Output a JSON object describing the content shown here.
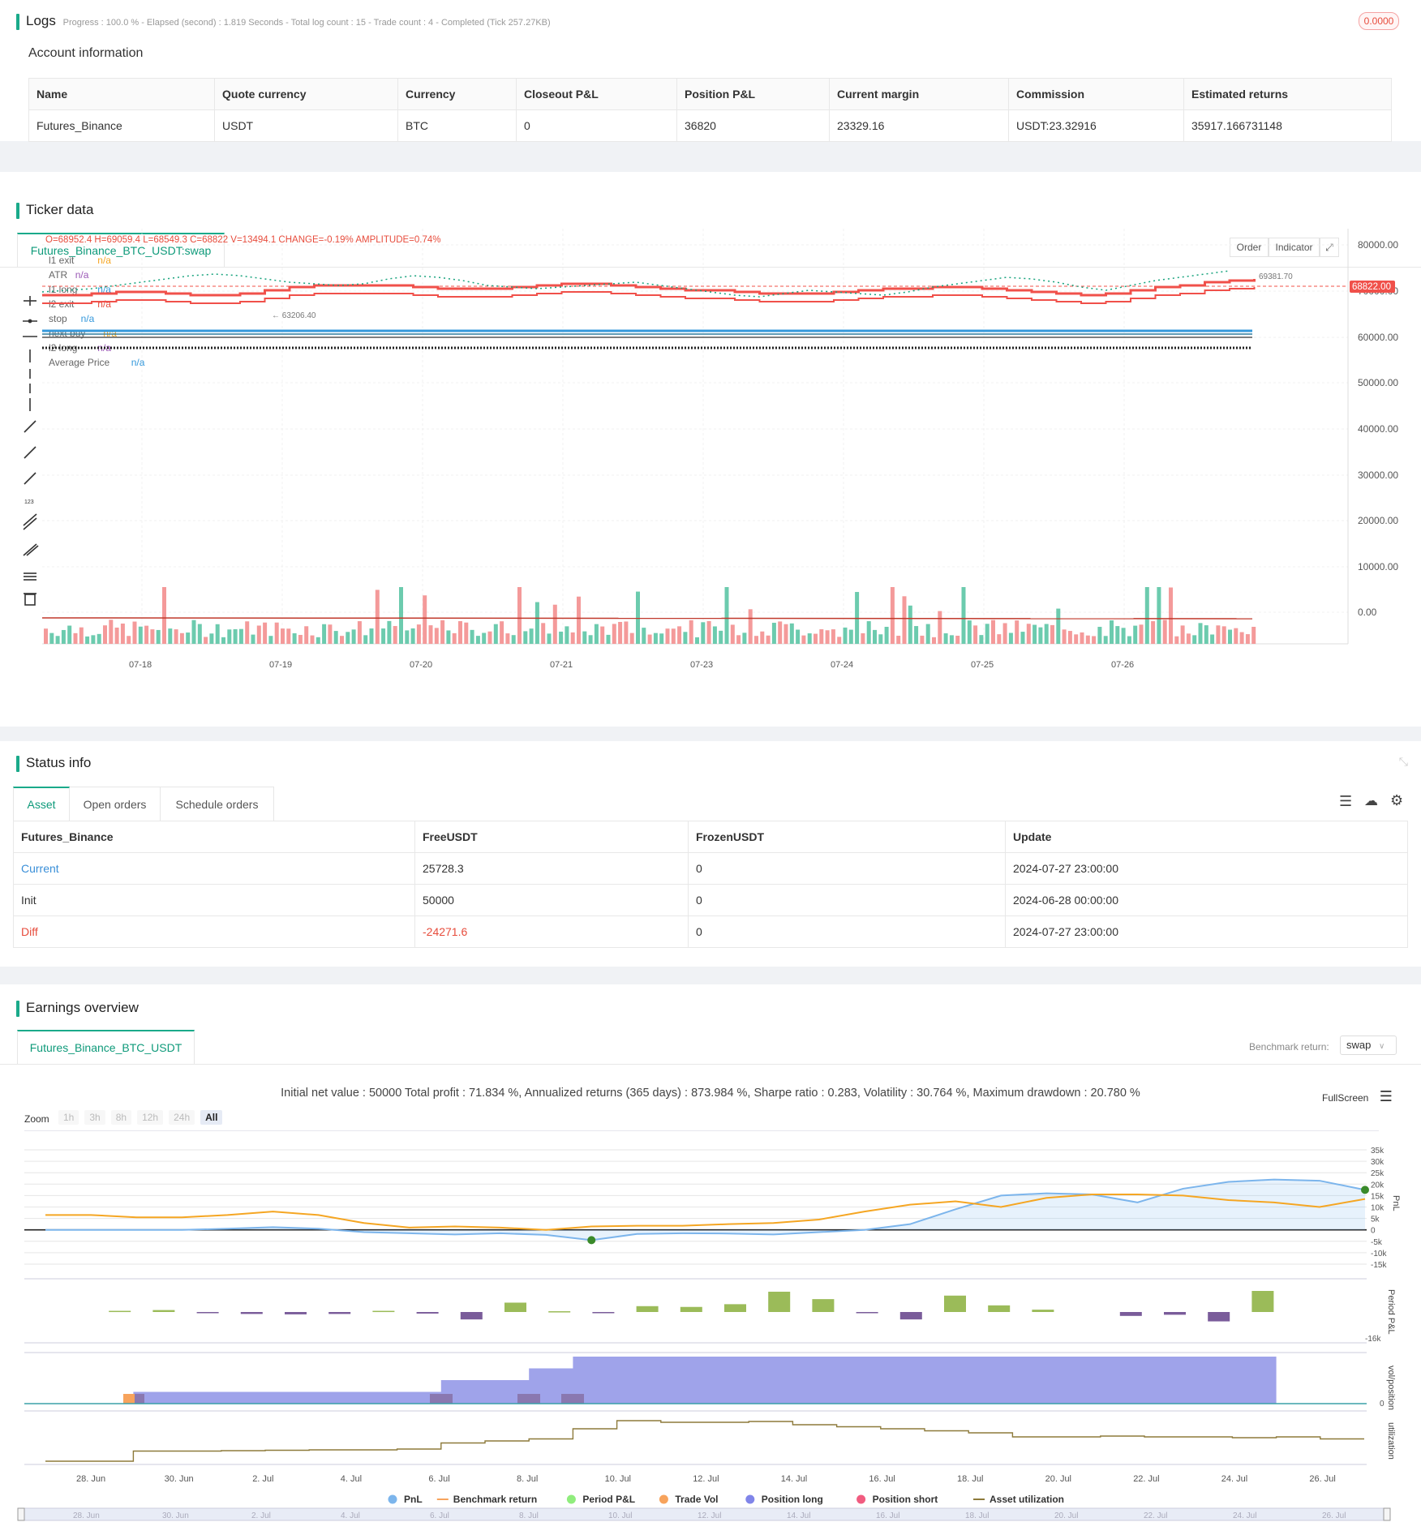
{
  "logs": {
    "title": "Logs",
    "status": "Progress : 100.0 % - Elapsed (second) : 1.819  Seconds - Total log count : 15 - Trade count : 4 - Completed (Tick 257.27KB)",
    "badge": "0.0000"
  },
  "account": {
    "title": "Account information",
    "columns": [
      "Name",
      "Quote currency",
      "Currency",
      "Closeout P&L",
      "Position P&L",
      "Current margin",
      "Commission",
      "Estimated returns"
    ],
    "row": [
      "Futures_Binance",
      "USDT",
      "BTC",
      "0",
      "36820",
      "23329.16",
      "USDT:23.32916",
      "35917.166731148"
    ]
  },
  "ticker": {
    "title": "Ticker data",
    "tab": "Futures_Binance_BTC_USDT:swap",
    "ohlc": "O=68952.4  H=69059.4  L=68549.3  C=68822  V=13494.1  CHANGE=-0.19%  AMPLITUDE=0.74%",
    "buttons": [
      "Order",
      "Indicator"
    ],
    "legend": [
      {
        "label": "l1 exit",
        "value": "n/a",
        "color": "#f5a623"
      },
      {
        "label": "ATR",
        "value": "n/a",
        "color": "#9b59b6"
      },
      {
        "label": "l1 long",
        "value": "n/a",
        "color": "#3498db"
      },
      {
        "label": "l2 exit",
        "value": "n/a",
        "color": "#e74c3c"
      },
      {
        "label": "stop",
        "value": "n/a",
        "color": "#3498db"
      },
      {
        "label": "next buy",
        "value": "n/a",
        "color": "#f5a623"
      },
      {
        "label": "l2 long",
        "value": "n/a",
        "color": "#9b59b6"
      },
      {
        "label": "Average Price",
        "value": "n/a",
        "color": "#3498db"
      }
    ],
    "y_ticks": [
      "80000.00",
      "70000.00",
      "60000.00",
      "50000.00",
      "40000.00",
      "30000.00",
      "20000.00",
      "10000.00",
      "0.00"
    ],
    "x_ticks": [
      "07-18",
      "07-19",
      "07-20",
      "07-21",
      "07-23",
      "07-24",
      "07-25",
      "07-26"
    ],
    "price_tag": "68822.00",
    "high_label": "69381.70",
    "low_label": "63206.40"
  },
  "status": {
    "title": "Status info",
    "tabs": [
      "Asset",
      "Open orders",
      "Schedule orders"
    ],
    "columns": [
      "Futures_Binance",
      "FreeUSDT",
      "FrozenUSDT",
      "Update"
    ],
    "rows": [
      {
        "name": "Current",
        "free": "25728.3",
        "frozen": "0",
        "update": "2024-07-27 23:00:00"
      },
      {
        "name": "Init",
        "free": "50000",
        "frozen": "0",
        "update": "2024-06-28 00:00:00"
      },
      {
        "name": "Diff",
        "free": "-24271.6",
        "frozen": "0",
        "update": "2024-07-27 23:00:00"
      }
    ]
  },
  "earnings": {
    "title": "Earnings overview",
    "tab": "Futures_Binance_BTC_USDT",
    "benchmark_label": "Benchmark return:",
    "benchmark_value": "swap",
    "summary": "Initial net value : 50000  Total profit : 71.834 %, Annualized returns (365 days) : 873.984 %, Sharpe ratio : 0.283, Volatility : 30.764 %, Maximum drawdown : 20.780 %",
    "fullscreen": "FullScreen",
    "zoom_label": "Zoom",
    "zoom_buttons": [
      "1h",
      "3h",
      "8h",
      "12h",
      "24h",
      "All"
    ],
    "pnl_ticks": [
      "35k",
      "30k",
      "25k",
      "20k",
      "15k",
      "10k",
      "5k",
      "0",
      "-5k",
      "-10k",
      "-15k"
    ],
    "period_tick": "-16k",
    "pos_tick": "0",
    "axis_titles": [
      "PnL",
      "Period P&L",
      "vol/position",
      "utilization"
    ],
    "x_ticks": [
      "28. Jun",
      "30. Jun",
      "2. Jul",
      "4. Jul",
      "6. Jul",
      "8. Jul",
      "10. Jul",
      "12. Jul",
      "14. Jul",
      "16. Jul",
      "18. Jul",
      "20. Jul",
      "22. Jul",
      "24. Jul",
      "26. Jul"
    ],
    "legend": [
      {
        "label": "PnL",
        "color": "#7cb5ec"
      },
      {
        "label": "Benchmark return",
        "color": "#f7a35c"
      },
      {
        "label": "Period P&L",
        "color": "#90ed7d"
      },
      {
        "label": "Trade Vol",
        "color": "#f7a35c"
      },
      {
        "label": "Position long",
        "color": "#8085e9"
      },
      {
        "label": "Position short",
        "color": "#f15c80"
      },
      {
        "label": "Asset utilization",
        "color": "#8d7a3a"
      }
    ]
  },
  "chart_data": [
    {
      "type": "line",
      "title": "",
      "x": [
        "28. Jun",
        "29. Jun",
        "30. Jun",
        "1. Jul",
        "2. Jul",
        "3. Jul",
        "4. Jul",
        "5. Jul",
        "6. Jul",
        "7. Jul",
        "8. Jul",
        "9. Jul",
        "10. Jul",
        "11. Jul",
        "12. Jul",
        "13. Jul",
        "14. Jul",
        "15. Jul",
        "16. Jul",
        "17. Jul",
        "18. Jul",
        "19. Jul",
        "20. Jul",
        "21. Jul",
        "22. Jul",
        "23. Jul",
        "24. Jul",
        "25. Jul",
        "26. Jul",
        "27. Jul"
      ],
      "series": [
        {
          "name": "PnL",
          "values": [
            0,
            0,
            0,
            0,
            500,
            1200,
            500,
            -1000,
            -1500,
            -2000,
            -1500,
            -2200,
            -4500,
            -1800,
            -1500,
            -1600,
            -2000,
            -1000,
            0,
            2500,
            9000,
            15000,
            16000,
            15500,
            12000,
            18000,
            21000,
            22000,
            21500,
            17500
          ]
        },
        {
          "name": "Benchmark return",
          "values": [
            6500,
            6500,
            5500,
            5500,
            6500,
            8000,
            6500,
            3000,
            1000,
            1500,
            1000,
            0,
            1500,
            1800,
            1800,
            2500,
            3000,
            4500,
            8000,
            11000,
            12500,
            10000,
            14000,
            15500,
            15500,
            15000,
            13000,
            12000,
            10000,
            13500
          ]
        }
      ],
      "ylim": [
        -15000,
        35000
      ]
    },
    {
      "type": "bar",
      "title": "",
      "series": [
        {
          "name": "Period P&L",
          "values": [
            0,
            300,
            500,
            -300,
            -500,
            -600,
            -500,
            300,
            -400,
            -1900,
            2400,
            200,
            -300,
            1500,
            1300,
            2000,
            5200,
            3300,
            -100,
            -1900,
            4200,
            1700,
            600,
            0,
            -1000,
            -700,
            -2400,
            5400
          ]
        }
      ]
    },
    {
      "type": "area",
      "title": "",
      "series": [
        {
          "name": "Position long",
          "values": [
            0,
            0,
            0.5,
            0.5,
            0.5,
            0.5,
            0.5,
            0.5,
            0.5,
            1.0,
            1.0,
            1.5,
            2.0,
            2.0,
            2.0,
            2.0,
            2.0,
            2.0,
            2.0,
            2.0,
            2.0,
            2.0,
            2.0,
            2.0,
            2.0,
            2.0,
            2.0,
            2.0,
            0
          ]
        }
      ]
    }
  ]
}
